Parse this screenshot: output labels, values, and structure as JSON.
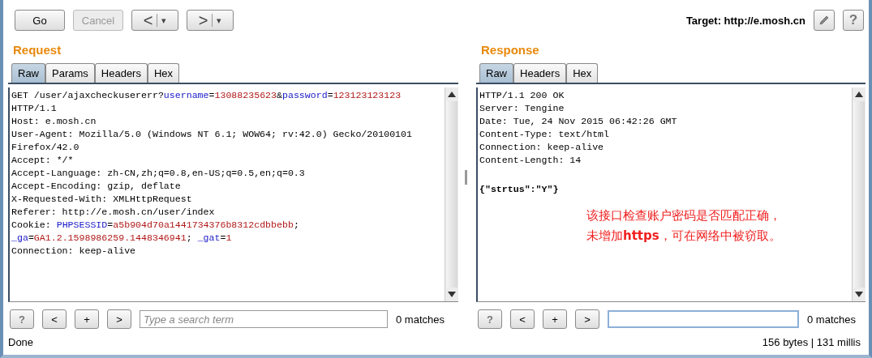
{
  "toolbar": {
    "buttons": [
      {
        "label": "Go",
        "disabled": false
      },
      {
        "label": "Cancel",
        "disabled": true
      }
    ],
    "back": {
      "label": "<",
      "menu": "▾"
    },
    "forward": {
      "label": ">",
      "menu": "▾"
    },
    "target": "Target: http://e.mosh.cn",
    "help": "?"
  },
  "request": {
    "title": "Request",
    "tabs": [
      {
        "label": "Raw",
        "selected": true
      },
      {
        "label": "Params",
        "selected": false
      },
      {
        "label": "Headers",
        "selected": false
      },
      {
        "label": "Hex",
        "selected": false
      }
    ],
    "lines": [
      [
        {
          "text": "GET /user/ajaxcheckusererr?",
          "kind": "plain"
        },
        {
          "text": "username",
          "kind": "name"
        },
        {
          "text": "=",
          "kind": "plain"
        },
        {
          "text": "13088235623",
          "kind": "value"
        },
        {
          "text": "&",
          "kind": "plain"
        },
        {
          "text": "password",
          "kind": "name"
        },
        {
          "text": "=",
          "kind": "plain"
        },
        {
          "text": "123123123123",
          "kind": "value"
        }
      ],
      [
        {
          "text": "HTTP/1.1",
          "kind": "plain"
        }
      ],
      [
        {
          "text": "Host: e.mosh.cn",
          "kind": "plain"
        }
      ],
      [
        {
          "text": "User-Agent: Mozilla/5.0 (Windows NT 6.1; WOW64; rv:42.0) Gecko/20100101",
          "kind": "plain"
        }
      ],
      [
        {
          "text": "Firefox/42.0",
          "kind": "plain"
        }
      ],
      [
        {
          "text": "Accept: */*",
          "kind": "plain"
        }
      ],
      [
        {
          "text": "Accept-Language: zh-CN,zh;q=0.8,en-US;q=0.5,en;q=0.3",
          "kind": "plain"
        }
      ],
      [
        {
          "text": "Accept-Encoding: gzip, deflate",
          "kind": "plain"
        }
      ],
      [
        {
          "text": "X-Requested-With: XMLHttpRequest",
          "kind": "plain"
        }
      ],
      [
        {
          "text": "Referer: http://e.mosh.cn/user/index",
          "kind": "plain"
        }
      ],
      [
        {
          "text": "Cookie: ",
          "kind": "plain"
        },
        {
          "text": "PHPSESSID",
          "kind": "name"
        },
        {
          "text": "=",
          "kind": "plain"
        },
        {
          "text": "a5b904d70a1441734376b8312cdbbebb",
          "kind": "value"
        },
        {
          "text": ";",
          "kind": "plain"
        }
      ],
      [
        {
          "text": "_ga",
          "kind": "name"
        },
        {
          "text": "=",
          "kind": "plain"
        },
        {
          "text": "GA1.2.1598986259.1448346941",
          "kind": "value"
        },
        {
          "text": "; ",
          "kind": "plain"
        },
        {
          "text": "_gat",
          "kind": "name"
        },
        {
          "text": "=",
          "kind": "plain"
        },
        {
          "text": "1",
          "kind": "value"
        }
      ],
      [
        {
          "text": "Connection: keep-alive",
          "kind": "plain"
        }
      ]
    ],
    "search": {
      "help": "?",
      "prev": "<",
      "add": "+",
      "next": ">",
      "placeholder": "Type a search term",
      "focused": false,
      "matches": "0 matches"
    }
  },
  "response": {
    "title": "Response",
    "tabs": [
      {
        "label": "Raw",
        "selected": true
      },
      {
        "label": "Headers",
        "selected": false
      },
      {
        "label": "Hex",
        "selected": false
      }
    ],
    "lines": [
      {
        "text": "HTTP/1.1 200 OK",
        "kind": "header"
      },
      {
        "text": "Server: Tengine",
        "kind": "header"
      },
      {
        "text": "Date: Tue, 24 Nov 2015 06:42:26 GMT",
        "kind": "header"
      },
      {
        "text": "Content-Type: text/html",
        "kind": "header"
      },
      {
        "text": "Connection: keep-alive",
        "kind": "header"
      },
      {
        "text": "Content-Length: 14",
        "kind": "header"
      },
      {
        "kind": "blank"
      },
      {
        "text": "{\"strtus\":\"Y\"}",
        "kind": "body"
      }
    ],
    "annotation": [
      "该接口检查账户密码是否匹配正确，",
      "未增加**https**，可在网络中被窃取。"
    ],
    "search": {
      "help": "?",
      "prev": "<",
      "add": "+",
      "next": ">",
      "focused": true,
      "matches": "0 matches"
    }
  },
  "status_bar": {
    "left": "Done",
    "right": "156 bytes | 131 millis"
  }
}
